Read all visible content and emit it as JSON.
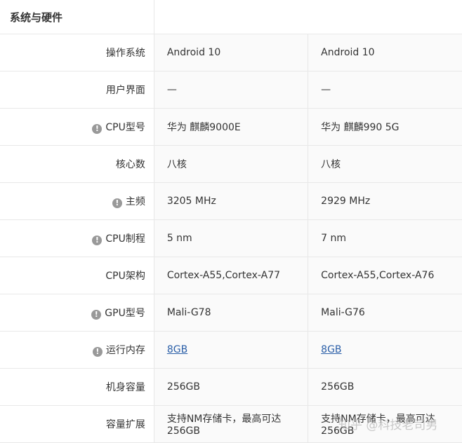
{
  "section_title": "系统与硬件",
  "rows": [
    {
      "label": "操作系统",
      "info": false,
      "v1": "Android 10",
      "v2": "Android 10",
      "link": false
    },
    {
      "label": "用户界面",
      "info": false,
      "v1": "—",
      "v2": "—",
      "link": false
    },
    {
      "label": "CPU型号",
      "info": true,
      "v1": "华为 麒麟9000E",
      "v2": "华为 麒麟990 5G",
      "link": false
    },
    {
      "label": "核心数",
      "info": false,
      "v1": "八核",
      "v2": "八核",
      "link": false
    },
    {
      "label": "主频",
      "info": true,
      "v1": "3205 MHz",
      "v2": "2929 MHz",
      "link": false
    },
    {
      "label": "CPU制程",
      "info": true,
      "v1": "5 nm",
      "v2": "7 nm",
      "link": false
    },
    {
      "label": "CPU架构",
      "info": false,
      "v1": "Cortex-A55,Cortex-A77",
      "v2": "Cortex-A55,Cortex-A76",
      "link": false
    },
    {
      "label": "GPU型号",
      "info": true,
      "v1": "Mali-G78",
      "v2": "Mali-G76",
      "link": false
    },
    {
      "label": "运行内存",
      "info": true,
      "v1": "8GB",
      "v2": "8GB",
      "link": true
    },
    {
      "label": "机身容量",
      "info": false,
      "v1": "256GB",
      "v2": "256GB",
      "link": false
    },
    {
      "label": "容量扩展",
      "info": false,
      "v1": "支持NM存储卡，最高可达256GB",
      "v2": "支持NM存储卡，最高可达256GB",
      "link": false
    }
  ],
  "info_icon_glyph": "!",
  "watermark": "知乎 @科技老司男"
}
